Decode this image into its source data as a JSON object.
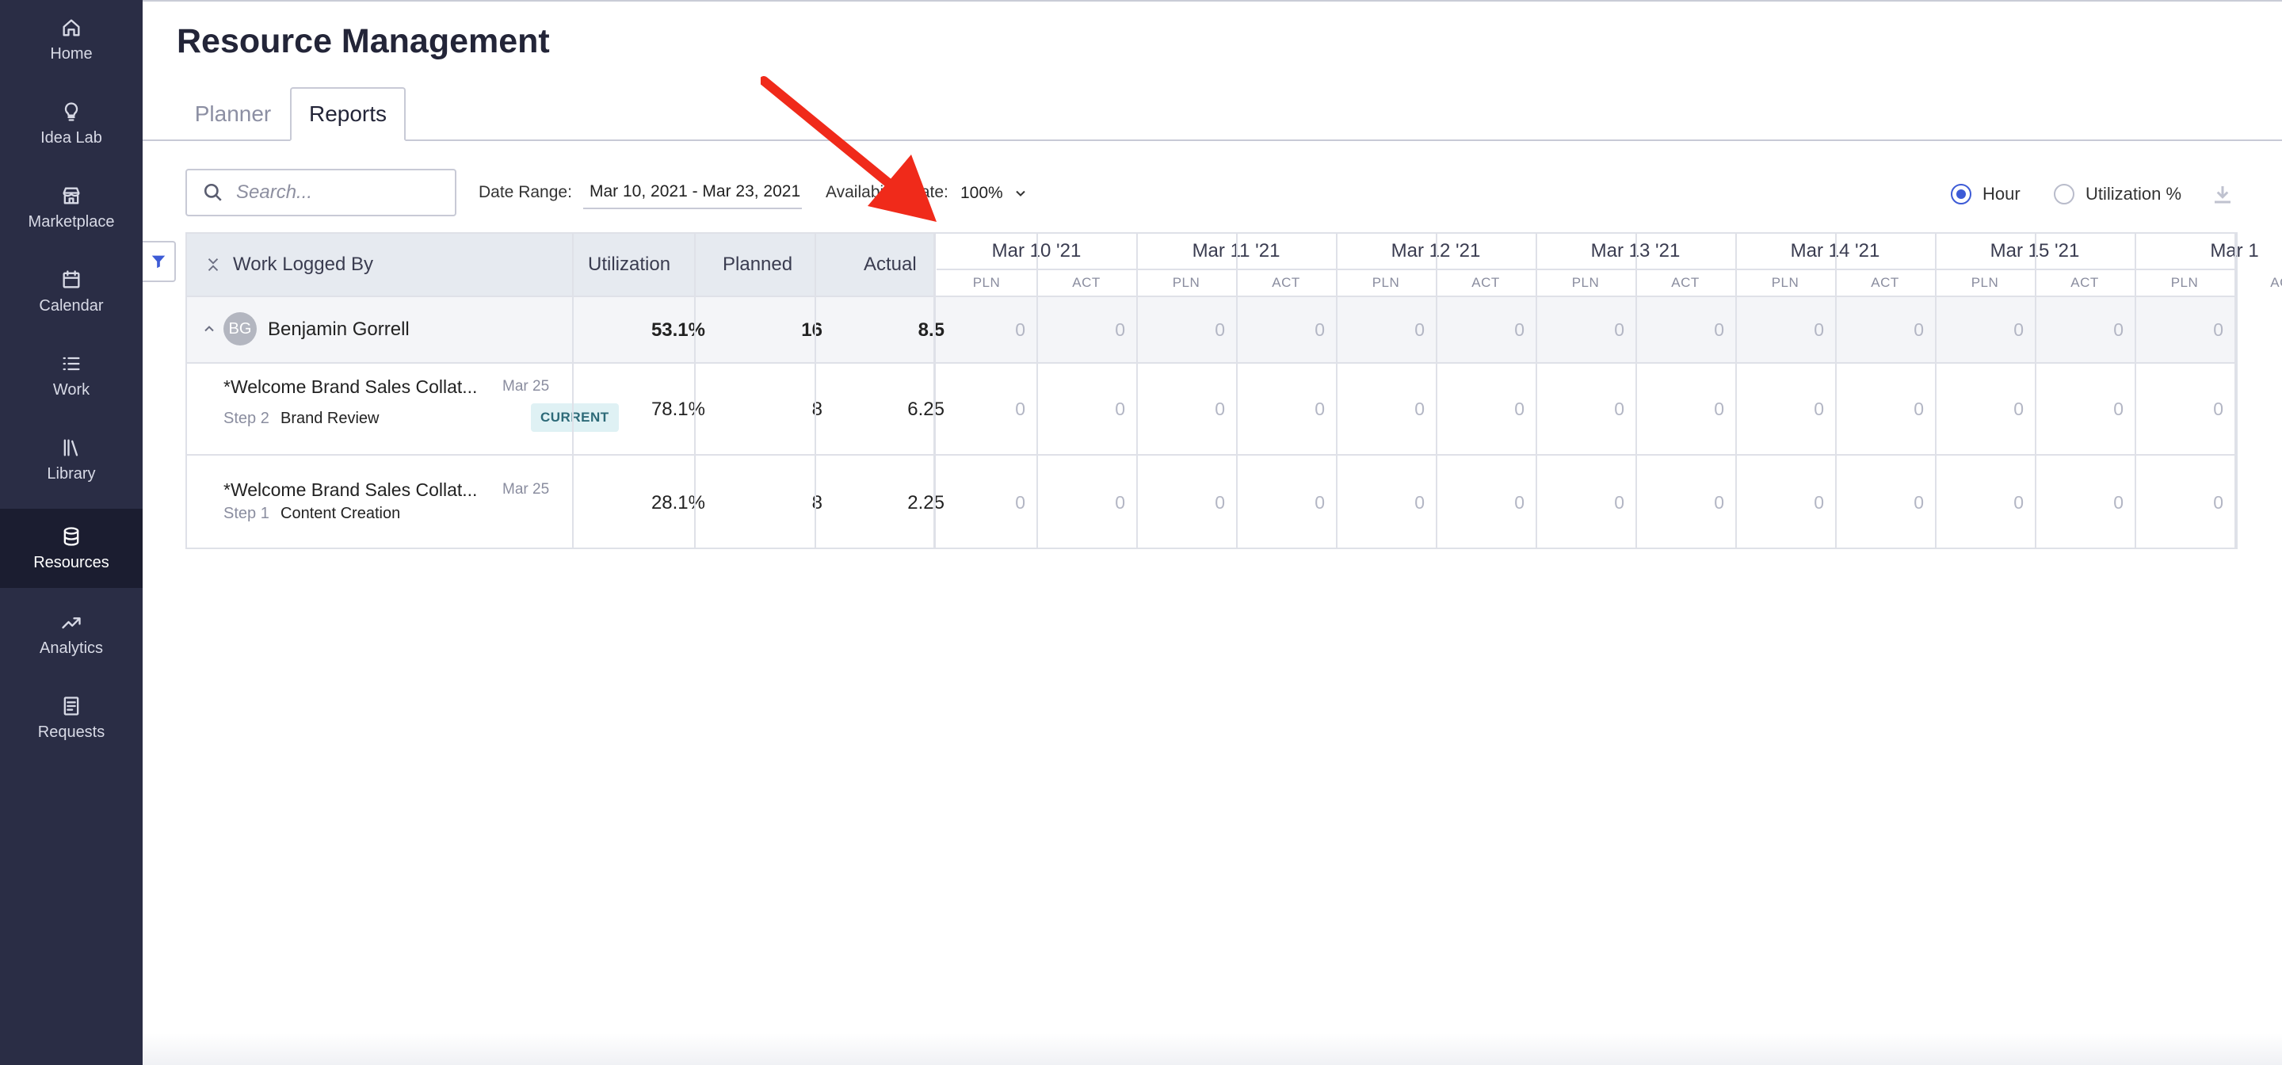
{
  "sidebar": {
    "items": [
      {
        "label": "Home",
        "icon": "home-icon"
      },
      {
        "label": "Idea Lab",
        "icon": "lightbulb-icon"
      },
      {
        "label": "Marketplace",
        "icon": "store-icon"
      },
      {
        "label": "Calendar",
        "icon": "calendar-icon"
      },
      {
        "label": "Work",
        "icon": "list-icon"
      },
      {
        "label": "Library",
        "icon": "library-icon"
      },
      {
        "label": "Resources",
        "icon": "database-icon",
        "active": true
      },
      {
        "label": "Analytics",
        "icon": "trend-icon"
      },
      {
        "label": "Requests",
        "icon": "document-icon"
      }
    ]
  },
  "page": {
    "title": "Resource Management"
  },
  "tabs": [
    {
      "label": "Planner",
      "active": false
    },
    {
      "label": "Reports",
      "active": true
    }
  ],
  "toolbar": {
    "search_placeholder": "Search...",
    "date_range_label": "Date Range:",
    "date_range_value": "Mar 10, 2021 - Mar 23, 2021",
    "availability_label": "Availability Rate:",
    "availability_value": "100%",
    "view_options": [
      {
        "label": "Hour",
        "selected": true
      },
      {
        "label": "Utilization %",
        "selected": false
      }
    ]
  },
  "table": {
    "columns": {
      "work_logged_by": "Work Logged By",
      "utilization": "Utilization",
      "planned": "Planned",
      "actual": "Actual"
    },
    "dates": [
      "Mar 10 '21",
      "Mar 11 '21",
      "Mar 12 '21",
      "Mar 13 '21",
      "Mar 14 '21",
      "Mar 15 '21",
      "Mar 1"
    ],
    "sub_columns": [
      "PLN",
      "ACT"
    ],
    "group": {
      "initials": "BG",
      "name": "Benjamin Gorrell",
      "utilization": "53.1%",
      "planned": "16",
      "actual": "8.5",
      "daily": [
        "0",
        "0",
        "0",
        "0",
        "0",
        "0",
        "0",
        "0",
        "0",
        "0",
        "0",
        "0",
        "0"
      ]
    },
    "rows": [
      {
        "title": "*Welcome Brand Sales Collat...",
        "due": "Mar 25",
        "step": "Step 2",
        "step_name": "Brand Review",
        "badge": "CURRENT",
        "utilization": "78.1%",
        "planned": "8",
        "actual": "6.25",
        "daily": [
          "0",
          "0",
          "0",
          "0",
          "0",
          "0",
          "0",
          "0",
          "0",
          "0",
          "0",
          "0",
          "0"
        ]
      },
      {
        "title": "*Welcome Brand Sales Collat...",
        "due": "Mar 25",
        "step": "Step 1",
        "step_name": "Content Creation",
        "badge": "",
        "utilization": "28.1%",
        "planned": "8",
        "actual": "2.25",
        "daily": [
          "0",
          "0",
          "0",
          "0",
          "0",
          "0",
          "0",
          "0",
          "0",
          "0",
          "0",
          "0",
          "0"
        ]
      }
    ]
  },
  "colors": {
    "sidebar_bg": "#2a2d45",
    "accent": "#3d5bd6",
    "annotation_arrow": "#f02a1a"
  }
}
